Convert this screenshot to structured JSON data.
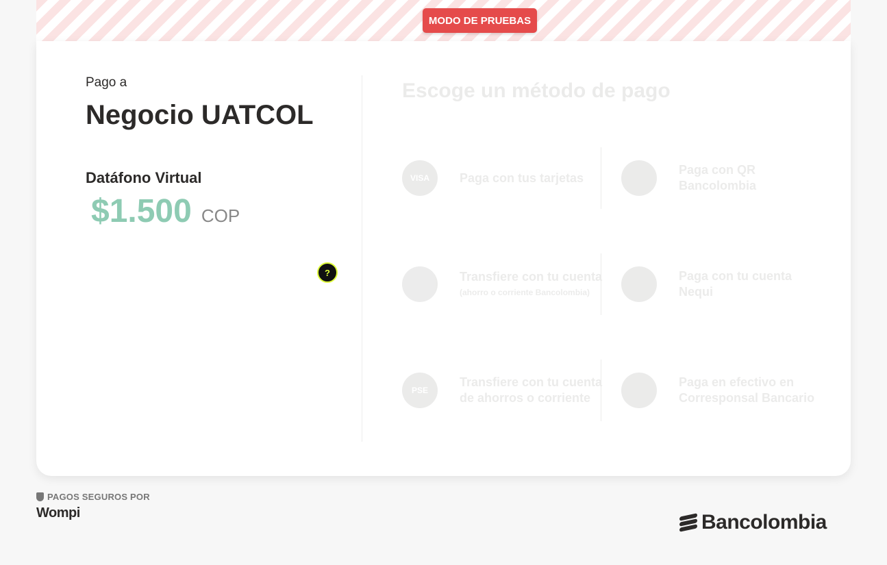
{
  "banner": {
    "label": "MODO DE PRUEBAS"
  },
  "payment": {
    "pay_to_label": "Pago a",
    "merchant_name": "Negocio UATCOL",
    "product_name": "Datáfono Virtual",
    "amount": "$1.500",
    "currency": "COP",
    "help_label": "?"
  },
  "methods": {
    "title": "Escoge un método de pago",
    "items": [
      {
        "label": "Paga con tus tarjetas",
        "sub": "",
        "icon": "card-brands-icon"
      },
      {
        "label": "Paga con QR Bancolombia",
        "sub": "",
        "icon": "qr-icon"
      },
      {
        "label": "Transfiere con tu cuenta",
        "sub": "(ahorro o corriente Bancolombia)",
        "icon": "bancolombia-icon"
      },
      {
        "label": "Paga con tu cuenta Nequi",
        "sub": "",
        "icon": "nequi-icon"
      },
      {
        "label": "Transfiere con tu cuenta de ahorros o corriente",
        "sub": "",
        "icon": "pse-icon"
      },
      {
        "label": "Paga en efectivo en Corresponsal Bancario",
        "sub": "",
        "icon": "cash-icon"
      }
    ],
    "card_brand_text": "VISA",
    "pse_text": "PSE"
  },
  "footer": {
    "secure_label": "PAGOS SEGUROS POR",
    "wompi_label": "Wompi",
    "bank_label": "Bancolombia"
  }
}
